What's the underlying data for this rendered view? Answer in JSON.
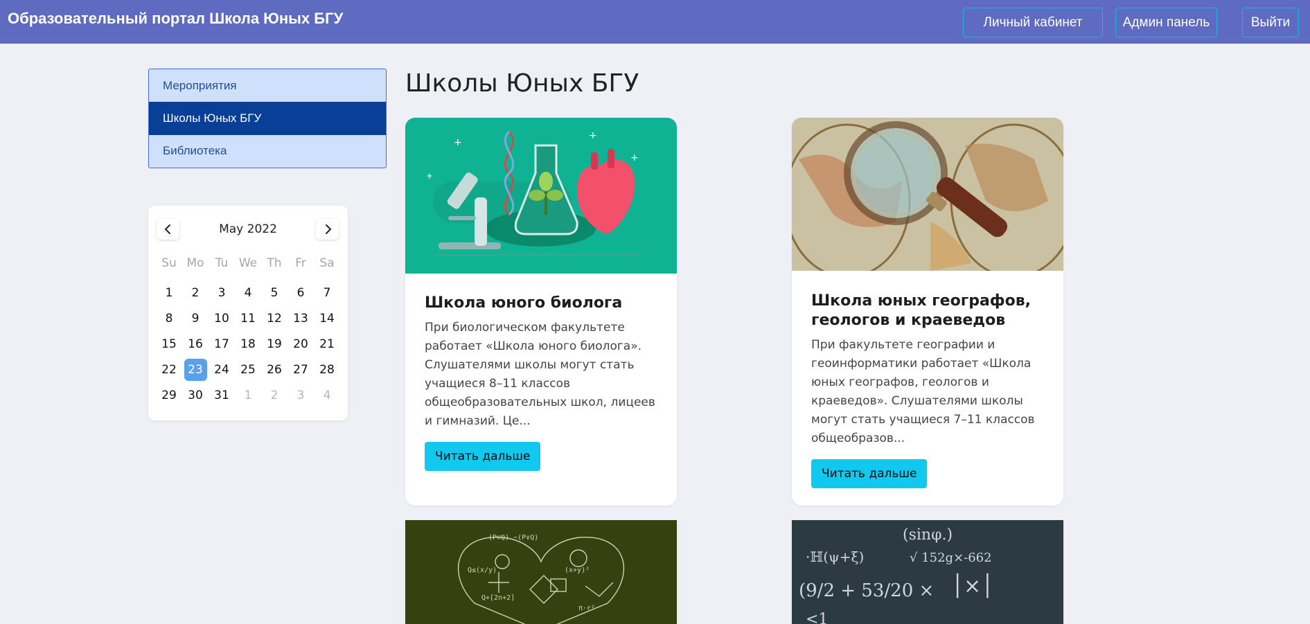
{
  "navbar": {
    "brand": "Образовательный портал Школа Юных БГУ",
    "buttons": [
      "Личный кабинет",
      "Админ панель",
      "Выйти"
    ]
  },
  "sidebar": {
    "items": [
      {
        "label": "Мероприятия",
        "active": false
      },
      {
        "label": "Школы Юных БГУ",
        "active": true
      },
      {
        "label": "Библиотека",
        "active": false
      }
    ]
  },
  "calendar": {
    "month_label": "May 2022",
    "weekdays": [
      "Su",
      "Mo",
      "Tu",
      "We",
      "Th",
      "Fr",
      "Sa"
    ],
    "weeks": [
      [
        "1",
        "2",
        "3",
        "4",
        "5",
        "6",
        "7"
      ],
      [
        "8",
        "9",
        "10",
        "11",
        "12",
        "13",
        "14"
      ],
      [
        "15",
        "16",
        "17",
        "18",
        "19",
        "20",
        "21"
      ],
      [
        "22",
        "23",
        "24",
        "25",
        "26",
        "27",
        "28"
      ],
      [
        "29",
        "30",
        "31",
        "1",
        "2",
        "3",
        "4"
      ]
    ],
    "selected_day": "23"
  },
  "main": {
    "title": "Школы Юных БГУ",
    "cards": [
      {
        "title": "Школа юного биолога",
        "text": "При биологическом факультете работает «Школа юного биолога». Слушателями школы могут стать учащиеся 8–11 классов общеобразовательных школ, лицеев и гимназий. Це...",
        "button": "Читать дальше"
      },
      {
        "title": "Школа юных географов, геологов и краеведов",
        "text": "При факультете географии и геоинформатики работает «Школа юных географов, геологов и краеведов». Слушателями школы могут стать учащиеся 7–11 классов общеобразов...",
        "button": "Читать дальше"
      }
    ]
  },
  "colors": {
    "navbar": "#5f6bc1",
    "accent_button": "#11c8ee",
    "sidebar_active": "#0a3f97",
    "sidebar_bg": "#cfe0fc",
    "page_bg": "#eff0f5"
  }
}
